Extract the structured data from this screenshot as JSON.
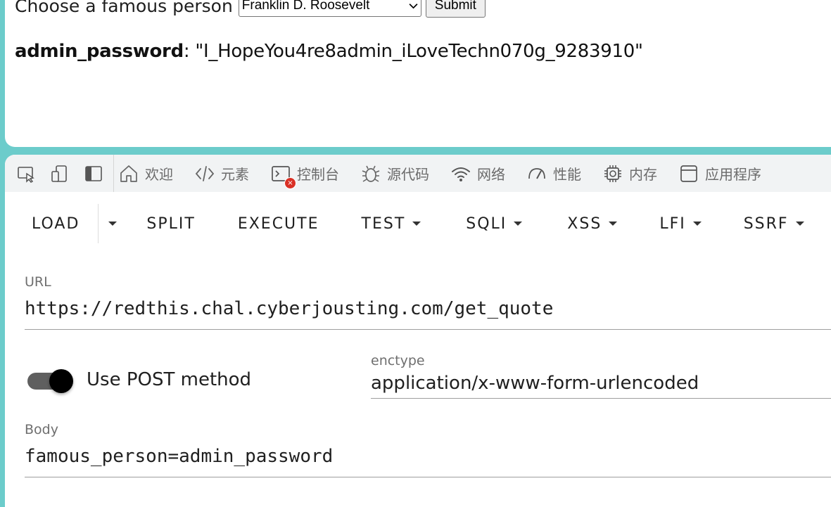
{
  "form": {
    "choose_label": "Choose a famous person",
    "selected_person": "Franklin D. Roosevelt",
    "submit_label": "Submit"
  },
  "result": {
    "key": "admin_password",
    "separator": ": ",
    "value": "\"I_HopeYou4re8admin_iLoveTechn070g_9283910\""
  },
  "devtools": {
    "tabs": [
      {
        "label": "欢迎",
        "icon": "home-icon"
      },
      {
        "label": "元素",
        "icon": "code-icon"
      },
      {
        "label": "控制台",
        "icon": "console-icon",
        "badge": "×"
      },
      {
        "label": "源代码",
        "icon": "bug-icon"
      },
      {
        "label": "网络",
        "icon": "wifi-icon"
      },
      {
        "label": "性能",
        "icon": "gauge-icon"
      },
      {
        "label": "内存",
        "icon": "chip-icon"
      },
      {
        "label": "应用程序",
        "icon": "app-window-icon"
      }
    ],
    "accent_color": "#6ccccb"
  },
  "hackbar": {
    "menu": {
      "load": "LOAD",
      "split": "SPLIT",
      "execute": "EXECUTE",
      "test": "TEST",
      "sqli": "SQLI",
      "xss": "XSS",
      "lfi": "LFI",
      "ssrf": "SSRF"
    },
    "url_label": "URL",
    "url_value": "https://redthis.chal.cyberjousting.com/get_quote",
    "post_label": "Use POST method",
    "post_enabled": true,
    "enctype_label": "enctype",
    "enctype_value": "application/x-www-form-urlencoded",
    "body_label": "Body",
    "body_value": "famous_person=admin_password"
  }
}
